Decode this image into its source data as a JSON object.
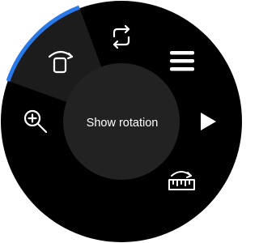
{
  "watch": {
    "center_label": "Show rotation",
    "colors": {
      "bezel": "#000000",
      "highlight_segment": "#1c1c1c",
      "hub": "#222222",
      "accent_arc": "#2979e8",
      "icon": "#ffffff"
    },
    "menu_items": [
      {
        "name": "rotation-button",
        "icon": "rotation-icon",
        "selected": true
      },
      {
        "name": "swap-button",
        "icon": "swap-arrows-icon",
        "selected": false
      },
      {
        "name": "menu-button",
        "icon": "hamburger-menu-icon",
        "selected": false
      },
      {
        "name": "play-button",
        "icon": "play-icon",
        "selected": false
      },
      {
        "name": "measure-button",
        "icon": "measure-ruler-icon",
        "selected": false
      },
      {
        "name": "zoom-button",
        "icon": "zoom-in-icon",
        "selected": false
      }
    ]
  }
}
